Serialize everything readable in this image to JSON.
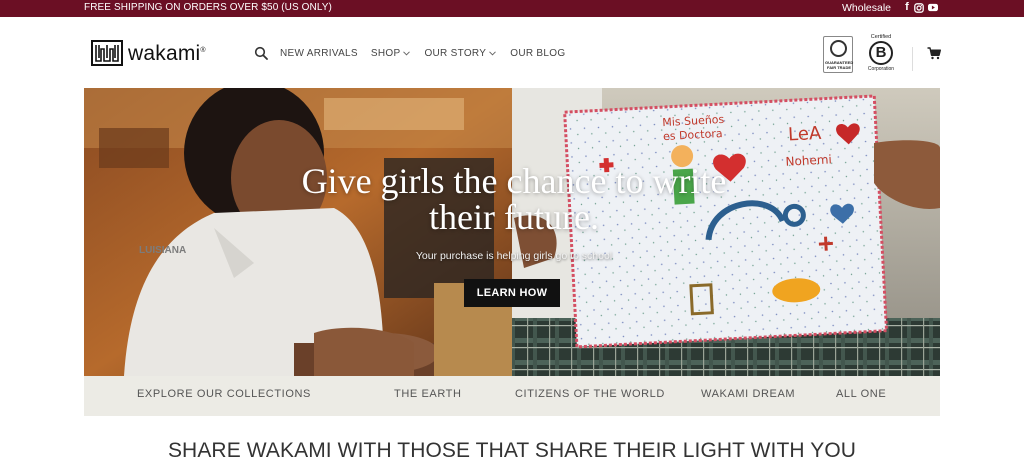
{
  "topbar": {
    "promo": "FREE SHIPPING ON ORDERS OVER $50 (US ONLY)",
    "wholesale": "Wholesale",
    "social": [
      "facebook-icon",
      "instagram-icon",
      "youtube-icon"
    ],
    "bg_color": "#6b0f24"
  },
  "header": {
    "logo_text": "wakami",
    "logo_reg": "®",
    "nav": [
      {
        "label": "NEW ARRIVALS"
      },
      {
        "label": "SHOP",
        "dropdown": true
      },
      {
        "label": "OUR STORY",
        "dropdown": true
      },
      {
        "label": "OUR BLOG"
      }
    ],
    "badges": {
      "fair_trade": "GUARANTEED FAIR TRADE",
      "bcorp_top": "Certified",
      "bcorp_letter": "B",
      "bcorp_bottom": "Corporation"
    }
  },
  "hero": {
    "title_line1": "Give girls the chance to write",
    "title_line2": "their future.",
    "subtitle": "Your purchase is helping girls go to school",
    "cta": "LEARN HOW",
    "drawing_text": {
      "line1": "Mis Sueños",
      "line2": "es Doctora",
      "name1": "LeA",
      "name2": "Nohemi"
    },
    "shirt_text": "LUISIANA"
  },
  "collections": {
    "items": [
      "EXPLORE OUR COLLECTIONS",
      "THE EARTH",
      "CITIZENS OF THE WORLD",
      "WAKAMI DREAM",
      "ALL ONE"
    ],
    "bg_color": "#ecebe5"
  },
  "share_heading": "SHARE WAKAMI WITH THOSE THAT SHARE THEIR LIGHT WITH YOU"
}
